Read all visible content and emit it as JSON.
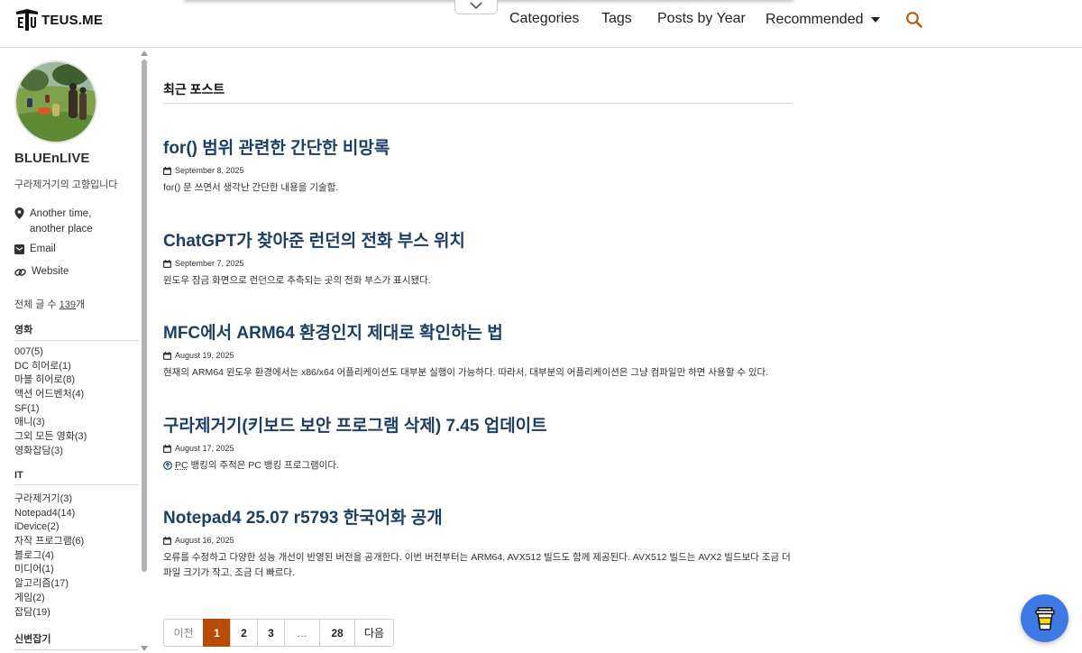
{
  "header": {
    "logo_text": "TEUS.ME",
    "nav": {
      "categories": "Categories",
      "tags": "Tags",
      "posts_by_year": "Posts by Year",
      "recommended": "Recommended"
    },
    "icons": [
      "logo-icon",
      "chevron-down-icon",
      "caret-down-icon",
      "search-icon"
    ],
    "search_color": "#c85a00"
  },
  "sidebar": {
    "author_name": "BLUEnLIVE",
    "bio": "구라제거기의 고향입니다",
    "location_line1": "Another time,",
    "location_line2": "another place",
    "email_label": "Email",
    "website_label": "Website",
    "total_prefix": "전체 글 수 ",
    "total_count": "139",
    "total_suffix": "개",
    "categories": [
      {
        "title": "영화",
        "items": [
          "007(5)",
          "DC 히어로(1)",
          "마블 히어로(8)",
          "액션 어드벤처(4)",
          "SF(1)",
          "애니(3)",
          "그외 모든 영화(3)",
          "영화잡담(3)"
        ]
      },
      {
        "title": "IT",
        "items": [
          "구라제거기(3)",
          "Notepad4(14)",
          "iDevice(2)",
          "자작 프로그램(6)",
          "블로그(4)",
          "미디어(1)",
          "알고리즘(17)",
          "게임(2)",
          "잡담(19)"
        ]
      },
      {
        "title": "신변잡기",
        "items": []
      }
    ]
  },
  "main": {
    "section_title": "최근 포스트",
    "posts": [
      {
        "title": "for() 범위 관련한 간단한 비망록",
        "date": "September 8, 2025",
        "excerpt": "for() 문 쓰면서 생각난 간단한 내용을 기술함."
      },
      {
        "title": "ChatGPT가 찾아준 런던의 전화 부스 위치",
        "date": "September 7, 2025",
        "excerpt": "윈도우 잠금 화면으로 런던으로 추측되는 곳의 전화 부스가 표시됐다."
      },
      {
        "title": "MFC에서 ARM64 환경인지 제대로 확인하는 법",
        "date": "August 19, 2025",
        "excerpt": "현재의 ARM64 윈도우 환경에서는 x86/x64 어플리케이션도 대부분 실행이 가능하다. 따라서, 대부분의 어플리케이션은 그냥 컴파일만 하면 사용할 수 있다."
      },
      {
        "title": "구라제거기(키보드 보안 프로그램 삭제) 7.45 업데이트",
        "date": "August 17, 2025",
        "excerpt_abbr": "PC",
        "excerpt": " 뱅킹의 주적은 PC 뱅킹 프로그램이다."
      },
      {
        "title": "Notepad4 25.07 r5793 한국어화 공개",
        "date": "August 16, 2025",
        "excerpt": "오류를 수정하고 다양한 성능 개선이 반영된 버전을 공개한다. 이번 버전부터는 ARM64, AVX512 빌드도 함께 제공된다. AVX512 빌드는 AVX2 빌드보다 조금 더 파일 크기가 작고, 조금 더 빠르다."
      }
    ]
  },
  "pagination": {
    "prev": "이전",
    "pages": [
      "1",
      "2",
      "3"
    ],
    "current": "1",
    "ellipsis": "…",
    "last": "28",
    "next": "다음",
    "accent_color": "#b74b00"
  },
  "floating_button": {
    "icon": "coffee-cup-icon",
    "color": "#3f79e6"
  }
}
